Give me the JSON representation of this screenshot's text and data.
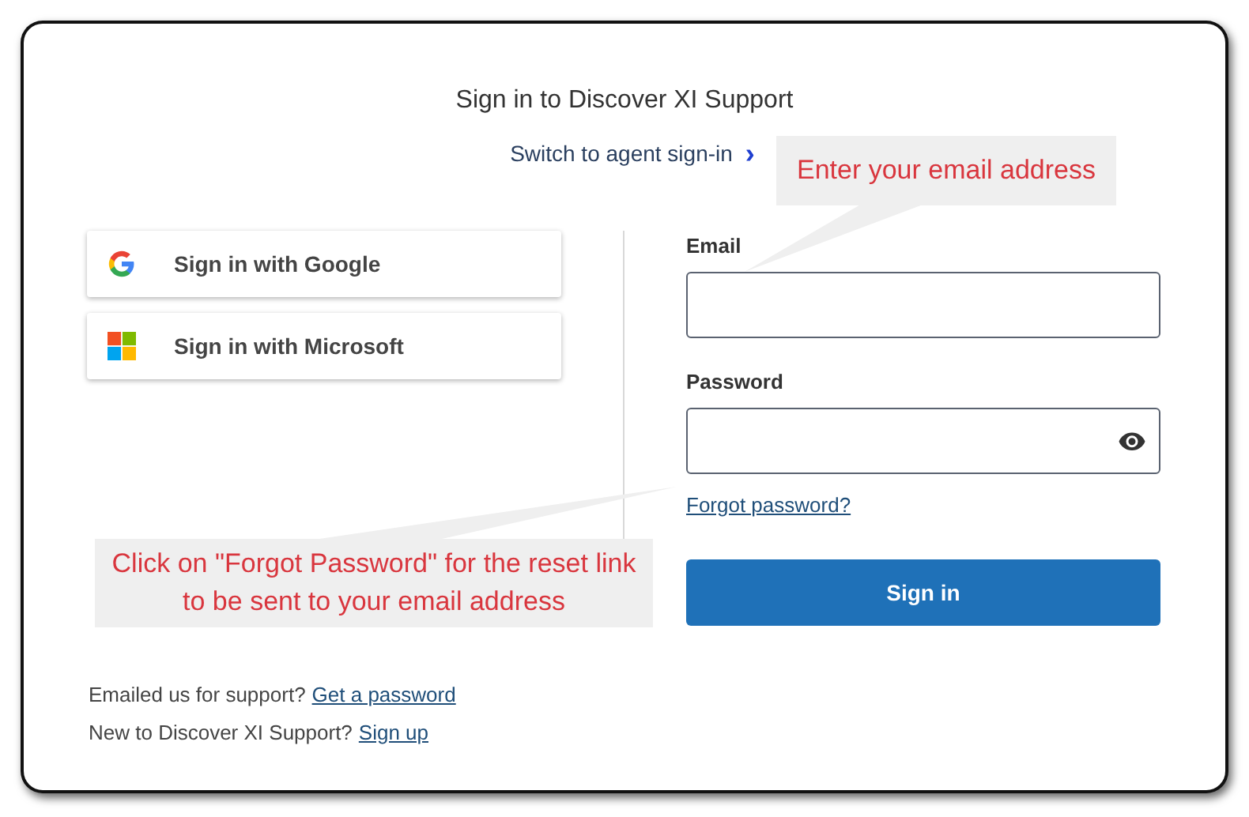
{
  "header": {
    "title": "Sign in to Discover XI Support",
    "switch_link": "Switch to agent sign-in",
    "switch_icon": "›"
  },
  "social_buttons": [
    {
      "kind": "google",
      "label": "Sign in with Google"
    },
    {
      "kind": "microsoft",
      "label": "Sign in with Microsoft"
    }
  ],
  "form": {
    "fields": [
      {
        "label": "Email",
        "kind": "text"
      },
      {
        "label": "Password",
        "kind": "password"
      }
    ],
    "forgot_link": "Forgot password?",
    "submit": "Sign in"
  },
  "footer_lines": [
    {
      "text": "Emailed us for support?",
      "link": "Get a password"
    },
    {
      "text": "New to Discover XI Support?",
      "link": "Sign up"
    }
  ],
  "callouts": [
    {
      "text": "Enter your email address"
    },
    {
      "text": "Click on \"Forgot Password\" for the reset link to be sent to your email address"
    }
  ]
}
